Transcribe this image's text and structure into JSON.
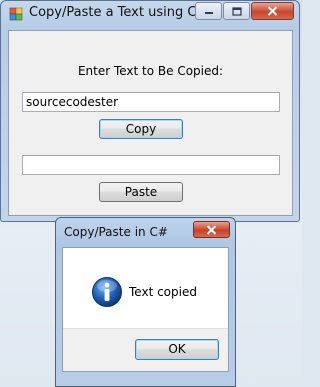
{
  "main_window": {
    "title": "Copy/Paste a Text using C#",
    "prompt_label": "Enter Text to Be Copied:",
    "source_textbox_value": "sourcecodester",
    "copy_button_label": "Copy",
    "target_textbox_value": "",
    "paste_button_label": "Paste"
  },
  "message_box": {
    "title": "Copy/Paste in C#",
    "message": "Text copied",
    "ok_button_label": "OK",
    "icon": "info-icon"
  },
  "colors": {
    "title_bar": "#bfd4ec",
    "close_button": "#c8412a",
    "client_area": "#f0f0f0",
    "info_icon": "#1f5fb4"
  }
}
